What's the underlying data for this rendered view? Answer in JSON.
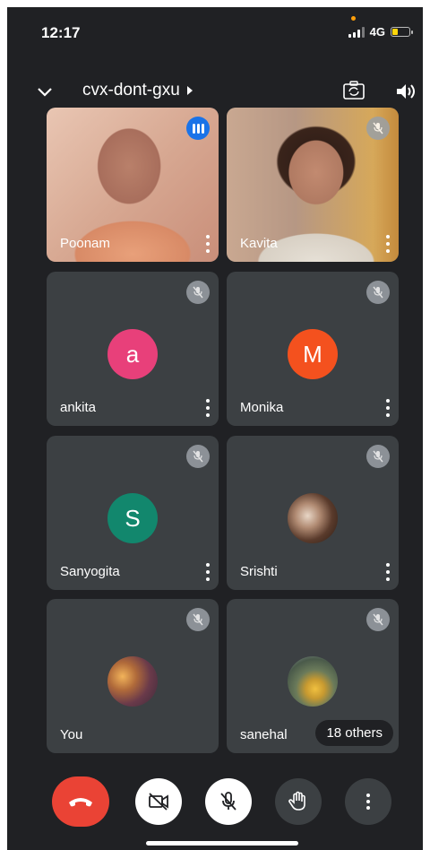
{
  "status_bar": {
    "time": "12:17",
    "network": "4G"
  },
  "meeting": {
    "code": "cvx-dont-gxu"
  },
  "participants": [
    {
      "name": "Poonam",
      "state": "speaking"
    },
    {
      "name": "Kavita",
      "state": "muted"
    },
    {
      "name": "ankita",
      "state": "muted",
      "initial": "a",
      "avatar_color": "#e8407a"
    },
    {
      "name": "Monika",
      "state": "muted",
      "initial": "M",
      "avatar_color": "#f4511e"
    },
    {
      "name": "Sanyogita",
      "state": "muted",
      "initial": "S",
      "avatar_color": "#12876d"
    },
    {
      "name": "Srishti",
      "state": "muted"
    },
    {
      "name": "You",
      "state": "muted"
    },
    {
      "name": "sanehal",
      "state": "muted"
    }
  ],
  "others_label": "18 others",
  "controls": {
    "icons": [
      "end-call-icon",
      "camera-off-icon",
      "mic-off-icon",
      "raise-hand-icon",
      "more-options-icon"
    ]
  },
  "colors": {
    "background": "#202124",
    "tile": "#3c4043",
    "end_call": "#ea4335",
    "speaking_badge": "#1a73e8"
  }
}
